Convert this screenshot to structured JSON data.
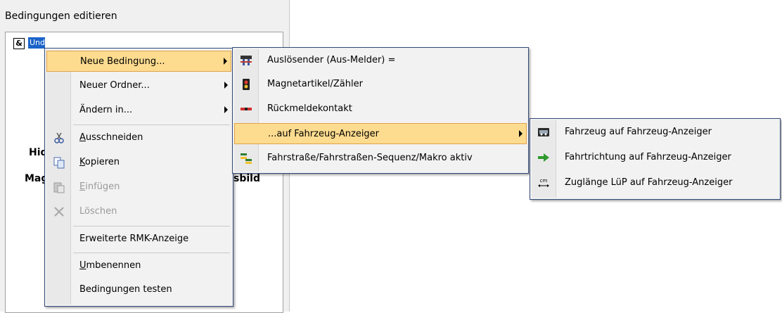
{
  "dialog": {
    "title": "Bedingungen editieren",
    "tree": {
      "root_icon_text": "&",
      "selected_node_text": "Und"
    },
    "bg_labels": [
      "Hid",
      "Mag",
      "sbild"
    ]
  },
  "context_menu": {
    "items": [
      {
        "label": "Neue Bedingung...",
        "submenu": true,
        "active": true
      },
      {
        "label": "Neuer Ordner...",
        "submenu": true
      },
      {
        "label": "Ändern in...",
        "submenu": true
      },
      {
        "label": "Ausschneiden",
        "icon": "scissors-icon",
        "underline": "A",
        "rest": "usschneiden"
      },
      {
        "label": "Kopieren",
        "icon": "copy-icon",
        "underline": "K",
        "rest": "opieren"
      },
      {
        "label": "Einfügen",
        "icon": "paste-icon",
        "underline": "E",
        "rest": "infügen",
        "disabled": true
      },
      {
        "label": "Löschen",
        "icon": "delete-icon",
        "disabled": true
      },
      {
        "label": "Erweiterte RMK-Anzeige"
      },
      {
        "label": "Umbenennen",
        "underline": "U",
        "rest": "mbenennen"
      },
      {
        "label": "Bedingungen testen"
      }
    ]
  },
  "submenu_conditions": {
    "items": [
      {
        "label": "Auslösender (Aus-Melder) =",
        "icon": "signal-sensor-icon"
      },
      {
        "label": "Magnetartikel/Zähler",
        "icon": "traffic-light-icon"
      },
      {
        "label": "Rückmeldekontakt",
        "icon": "feedback-contact-icon"
      },
      {
        "label": "...auf Fahrzeug-Anzeiger",
        "submenu": true,
        "active": true
      },
      {
        "label": "Fahrstraße/Fahrstraßen-Sequenz/Makro aktiv",
        "icon": "route-icon"
      }
    ]
  },
  "submenu_vehicle": {
    "items": [
      {
        "label": "Fahrzeug auf Fahrzeug-Anzeiger",
        "icon": "vehicle-icon"
      },
      {
        "label": "Fahrtrichtung auf Fahrzeug-Anzeiger",
        "icon": "green-arrow-icon"
      },
      {
        "label": "Zuglänge LüP auf Fahrzeug-Anzeiger",
        "icon": "length-cm-icon",
        "icon_text": "cm"
      }
    ]
  }
}
